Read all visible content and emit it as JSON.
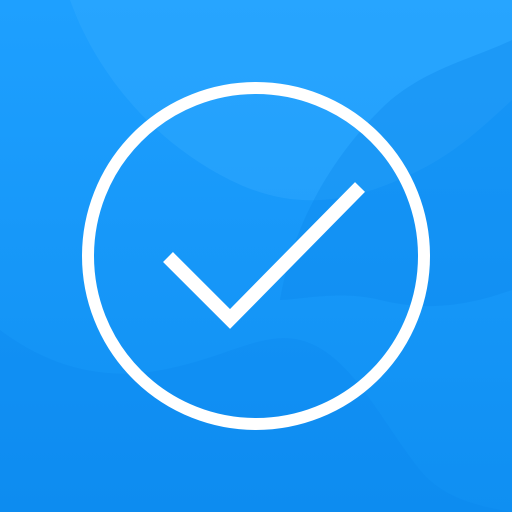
{
  "icon": {
    "name": "checkmark-circle-app-icon",
    "symbol": "check-circle-icon",
    "colors": {
      "background_top": "#1ea0ff",
      "background_bottom": "#0f8ff2",
      "wave_light": "#3aaeff",
      "wave_dark": "#0b86ec",
      "foreground": "#ffffff"
    }
  }
}
